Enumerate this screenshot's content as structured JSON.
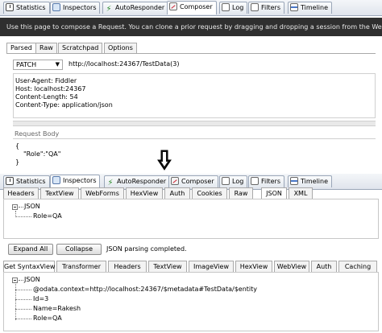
{
  "top_tabs": [
    {
      "label": "Statistics",
      "icon": "statistics-icon"
    },
    {
      "label": "Inspectors",
      "icon": "inspectors-icon"
    },
    {
      "label": "AutoResponder",
      "icon": "autoresponder-icon"
    },
    {
      "label": "Composer",
      "icon": "composer-icon"
    },
    {
      "label": "Log",
      "icon": "log-icon"
    },
    {
      "label": "Filters",
      "icon": "filters-icon"
    },
    {
      "label": "Timeline",
      "icon": "timeline-icon"
    }
  ],
  "info_text": "Use this page to compose a Request. You can clone a prior request by dragging and dropping a session from the We",
  "composer": {
    "tabs": [
      "Parsed",
      "Raw",
      "Scratchpad",
      "Options"
    ],
    "method": "PATCH",
    "url": "http://localhost:24367/TestData(3)",
    "headers": [
      "User-Agent: Fiddler",
      "Host: localhost:24367",
      "Content-Length: 54",
      "Content-Type: application/json"
    ],
    "request_body_label": "Request Body",
    "body_lines": [
      "{",
      "\"Role\":\"QA\"",
      "}"
    ]
  },
  "bottom_tabs": [
    {
      "label": "Statistics",
      "icon": "statistics-icon"
    },
    {
      "label": "Inspectors",
      "icon": "inspectors-icon"
    },
    {
      "label": "AutoResponder",
      "icon": "autoresponder-icon"
    },
    {
      "label": "Composer",
      "icon": "composer-icon"
    },
    {
      "label": "Log",
      "icon": "log-icon"
    },
    {
      "label": "Filters",
      "icon": "filters-icon"
    },
    {
      "label": "Timeline",
      "icon": "timeline-icon"
    }
  ],
  "request_inspector_tabs": [
    "Headers",
    "TextView",
    "WebForms",
    "HexView",
    "Auth",
    "Cookies",
    "Raw",
    "JSON",
    "XML"
  ],
  "request_tree": {
    "root": "JSON",
    "child": "Role=QA"
  },
  "buttons": {
    "expand_all": "Expand All",
    "collapse": "Collapse"
  },
  "status_text": "JSON parsing completed.",
  "response_inspector_tabs": [
    "Get SyntaxView",
    "Transformer",
    "Headers",
    "TextView",
    "ImageView",
    "HexView",
    "WebView",
    "Auth",
    "Caching"
  ],
  "response_tree": {
    "root": "JSON",
    "children": [
      "@odata.context=http://localhost:24367/$metadata#TestData/$entity",
      "Id=3",
      "Name=Rakesh",
      "Role=QA"
    ]
  }
}
